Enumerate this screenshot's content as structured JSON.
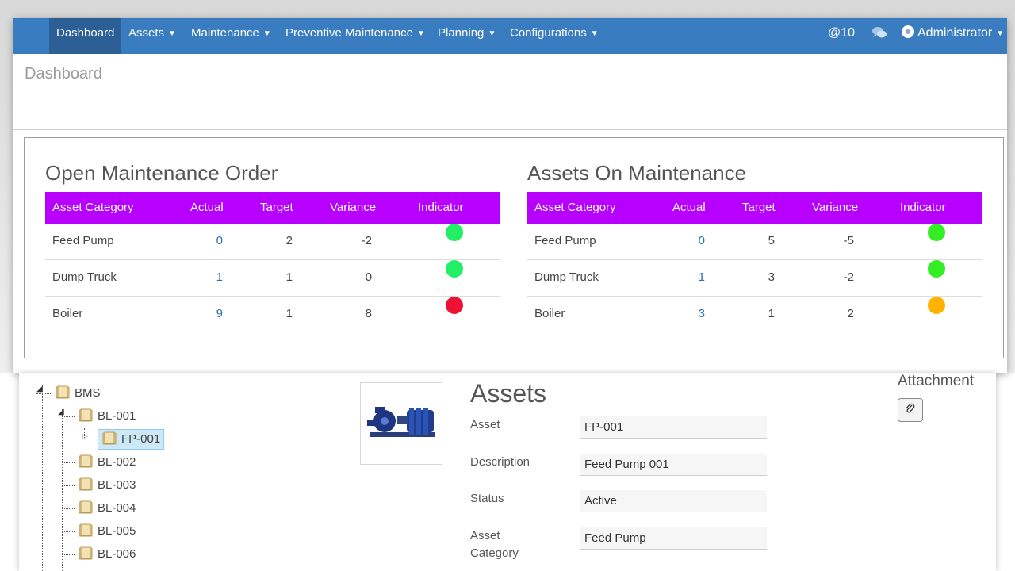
{
  "navbar": {
    "items": [
      {
        "label": "Dashboard"
      },
      {
        "label": "Assets"
      },
      {
        "label": "Maintenance"
      },
      {
        "label": "Preventive Maintenance"
      },
      {
        "label": "Planning"
      },
      {
        "label": "Configurations"
      }
    ],
    "mentions": "@10",
    "user": "Administrator"
  },
  "page": {
    "title": "Dashboard"
  },
  "open_maintenance": {
    "title": "Open Maintenance Order",
    "headers": [
      "Asset Category",
      "Actual",
      "Target",
      "Variance",
      "Indicator"
    ],
    "rows": [
      {
        "category": "Feed Pump",
        "actual": "0",
        "target": "2",
        "variance": "-2",
        "indicator": "#22ee66"
      },
      {
        "category": "Dump Truck",
        "actual": "1",
        "target": "1",
        "variance": "0",
        "indicator": "#22ee66"
      },
      {
        "category": "Boiler",
        "actual": "9",
        "target": "1",
        "variance": "8",
        "indicator": "#ee1133"
      }
    ]
  },
  "assets_on_maintenance": {
    "title": "Assets On Maintenance",
    "headers": [
      "Asset Category",
      "Actual",
      "Target",
      "Variance",
      "Indicator"
    ],
    "rows": [
      {
        "category": "Feed Pump",
        "actual": "0",
        "target": "5",
        "variance": "-5",
        "indicator": "#33ee22"
      },
      {
        "category": "Dump Truck",
        "actual": "1",
        "target": "3",
        "variance": "-2",
        "indicator": "#33ee22"
      },
      {
        "category": "Boiler",
        "actual": "3",
        "target": "1",
        "variance": "2",
        "indicator": "#ffb300"
      }
    ]
  },
  "tree": {
    "root": "BMS",
    "nodes": [
      "BL-001",
      "FP-001",
      "BL-002",
      "BL-003",
      "BL-004",
      "BL-005",
      "BL-006"
    ]
  },
  "asset_detail": {
    "title": "Assets",
    "fields": [
      {
        "label": "Asset",
        "value": "FP-001"
      },
      {
        "label": "Description",
        "value": "Feed Pump 001"
      },
      {
        "label": "Status",
        "value": "Active"
      },
      {
        "label": "Asset Category",
        "value": "Feed Pump"
      }
    ],
    "attachment_title": "Attachment"
  },
  "colors": {
    "navbar": "#3a7cc0",
    "table_header": "#b800ff",
    "link": "#2d6fb3"
  }
}
